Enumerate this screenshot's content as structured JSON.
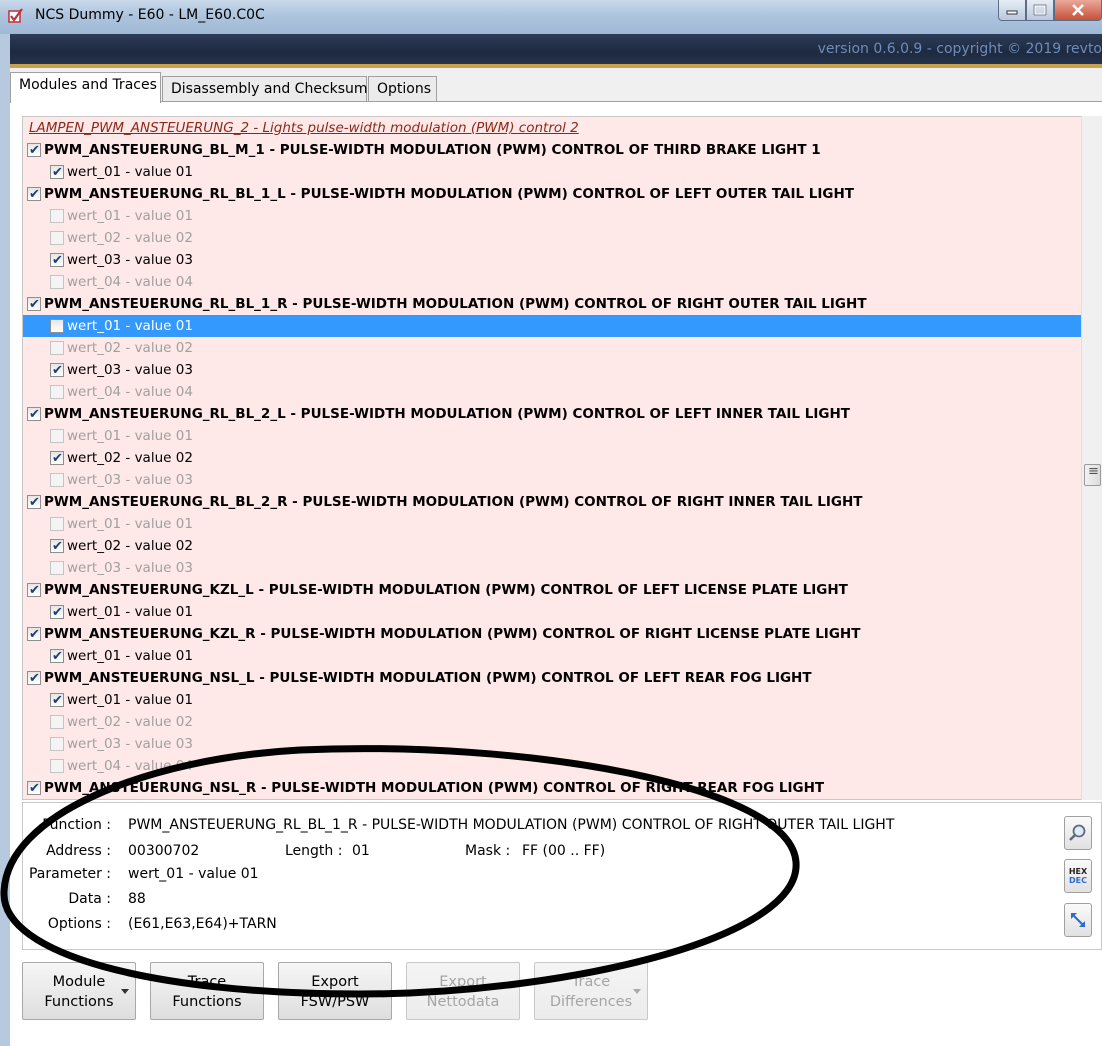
{
  "window": {
    "title": "NCS Dummy - E60 - LM_E60.C0C",
    "version": "version 0.6.0.9 - copyright © 2019 revto"
  },
  "tabs": [
    {
      "label": "Modules and Traces",
      "active": true
    },
    {
      "label": "Disassembly and Checksums",
      "active": false
    },
    {
      "label": "Options",
      "active": false
    }
  ],
  "list": {
    "header": "LAMPEN_PWM_ANSTEUERUNG_2  -  Lights pulse-width modulation (PWM) control 2",
    "rows": [
      {
        "kind": "func",
        "checked": true,
        "text": "PWM_ANSTEUERUNG_BL_M_1  -  PULSE-WIDTH MODULATION (PWM) CONTROL OF THIRD BRAKE LIGHT 1"
      },
      {
        "kind": "param",
        "checked": true,
        "disabled": false,
        "text": "wert_01  -  value 01"
      },
      {
        "kind": "func",
        "checked": true,
        "text": "PWM_ANSTEUERUNG_RL_BL_1_L  -  PULSE-WIDTH MODULATION (PWM) CONTROL OF LEFT OUTER TAIL LIGHT"
      },
      {
        "kind": "param",
        "checked": false,
        "disabled": true,
        "text": "wert_01  -  value 01"
      },
      {
        "kind": "param",
        "checked": false,
        "disabled": true,
        "text": "wert_02  -  value 02"
      },
      {
        "kind": "param",
        "checked": true,
        "disabled": false,
        "text": "wert_03  -  value 03"
      },
      {
        "kind": "param",
        "checked": false,
        "disabled": true,
        "text": "wert_04  -  value 04"
      },
      {
        "kind": "func",
        "checked": true,
        "text": "PWM_ANSTEUERUNG_RL_BL_1_R  -  PULSE-WIDTH MODULATION (PWM) CONTROL OF RIGHT OUTER TAIL LIGHT"
      },
      {
        "kind": "param",
        "checked": false,
        "disabled": false,
        "selected": true,
        "text": "wert_01  -  value 01"
      },
      {
        "kind": "param",
        "checked": false,
        "disabled": true,
        "text": "wert_02  -  value 02"
      },
      {
        "kind": "param",
        "checked": true,
        "disabled": false,
        "text": "wert_03  -  value 03"
      },
      {
        "kind": "param",
        "checked": false,
        "disabled": true,
        "text": "wert_04  -  value 04"
      },
      {
        "kind": "func",
        "checked": true,
        "text": "PWM_ANSTEUERUNG_RL_BL_2_L  -  PULSE-WIDTH MODULATION (PWM) CONTROL OF LEFT INNER TAIL LIGHT"
      },
      {
        "kind": "param",
        "checked": false,
        "disabled": true,
        "text": "wert_01  -  value 01"
      },
      {
        "kind": "param",
        "checked": true,
        "disabled": false,
        "text": "wert_02  -  value 02"
      },
      {
        "kind": "param",
        "checked": false,
        "disabled": true,
        "text": "wert_03  -  value 03"
      },
      {
        "kind": "func",
        "checked": true,
        "text": "PWM_ANSTEUERUNG_RL_BL_2_R  -  PULSE-WIDTH MODULATION (PWM) CONTROL OF RIGHT INNER TAIL LIGHT"
      },
      {
        "kind": "param",
        "checked": false,
        "disabled": true,
        "text": "wert_01  -  value 01"
      },
      {
        "kind": "param",
        "checked": true,
        "disabled": false,
        "text": "wert_02  -  value 02"
      },
      {
        "kind": "param",
        "checked": false,
        "disabled": true,
        "text": "wert_03  -  value 03"
      },
      {
        "kind": "func",
        "checked": true,
        "text": "PWM_ANSTEUERUNG_KZL_L  -  PULSE-WIDTH MODULATION (PWM) CONTROL OF LEFT LICENSE PLATE LIGHT"
      },
      {
        "kind": "param",
        "checked": true,
        "disabled": false,
        "text": "wert_01  -  value 01"
      },
      {
        "kind": "func",
        "checked": true,
        "text": "PWM_ANSTEUERUNG_KZL_R  -  PULSE-WIDTH MODULATION (PWM) CONTROL OF RIGHT LICENSE PLATE LIGHT"
      },
      {
        "kind": "param",
        "checked": true,
        "disabled": false,
        "text": "wert_01  -  value 01"
      },
      {
        "kind": "func",
        "checked": true,
        "text": "PWM_ANSTEUERUNG_NSL_L  -  PULSE-WIDTH MODULATION (PWM) CONTROL OF LEFT REAR FOG LIGHT"
      },
      {
        "kind": "param",
        "checked": true,
        "disabled": false,
        "text": "wert_01  -  value 01"
      },
      {
        "kind": "param",
        "checked": false,
        "disabled": true,
        "text": "wert_02  -  value 02"
      },
      {
        "kind": "param",
        "checked": false,
        "disabled": true,
        "text": "wert_03  -  value 03"
      },
      {
        "kind": "param",
        "checked": false,
        "disabled": true,
        "text": "wert_04  -  value 04"
      },
      {
        "kind": "func",
        "checked": true,
        "text": "PWM_ANSTEUERUNG_NSL_R  -  PULSE-WIDTH MODULATION (PWM) CONTROL OF RIGHT REAR FOG LIGHT"
      }
    ]
  },
  "detail": {
    "function_label": "Function :",
    "function_value": "PWM_ANSTEUERUNG_RL_BL_1_R  -  PULSE-WIDTH MODULATION (PWM) CONTROL OF RIGHT OUTER TAIL LIGHT",
    "address_label": "Address :",
    "address_value": "00300702",
    "length_label": "Length :",
    "length_value": "01",
    "mask_label": "Mask :",
    "mask_value": "FF  (00 .. FF)",
    "parameter_label": "Parameter :",
    "parameter_value": "wert_01  -  value 01",
    "data_label": "Data :",
    "data_value": "88",
    "options_label": "Options :",
    "options_value": "(E61,E63,E64)+TARN",
    "hexdec_top": "HEX",
    "hexdec_bottom": "DEC"
  },
  "buttons": [
    {
      "line1": "Module",
      "line2": "Functions",
      "dropdown": true,
      "disabled": false
    },
    {
      "line1": "Trace",
      "line2": "Functions",
      "dropdown": true,
      "disabled": false
    },
    {
      "line1": "Export",
      "line2": "FSW/PSW",
      "dropdown": false,
      "disabled": false
    },
    {
      "line1": "Export",
      "line2": "Nettodata",
      "dropdown": false,
      "disabled": true
    },
    {
      "line1": "Trace",
      "line2": "Differences",
      "dropdown": true,
      "disabled": true
    }
  ],
  "colors": {
    "list_bg": "#ffe8e8",
    "selection": "#3399ff",
    "header_text": "#8b2a1a",
    "banner_bg": "#1d2a40",
    "version_text": "#6f8bb8",
    "annotation": "#000000"
  },
  "icons": {
    "app": "checkbox-app-icon",
    "search": "magnifier-icon",
    "hexdec": "hex-dec-toggle-icon",
    "resize": "resize-arrows-icon"
  }
}
